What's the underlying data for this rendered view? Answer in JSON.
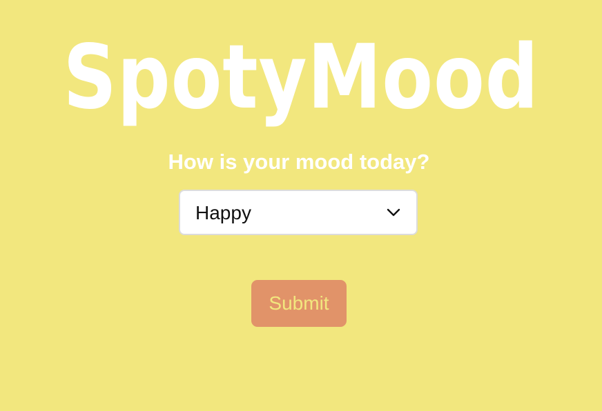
{
  "app": {
    "logo_text": "SpotyMood"
  },
  "form": {
    "question": "How is your mood today?",
    "mood_select": {
      "selected": "Happy",
      "icon": "chevron-down-icon"
    },
    "submit_label": "Submit"
  },
  "colors": {
    "background": "#f2e77e",
    "logo": "#ffffff",
    "question_text": "#ffffff",
    "select_background": "#ffffff",
    "button_background": "#e19369",
    "button_text": "#f2e77e"
  }
}
